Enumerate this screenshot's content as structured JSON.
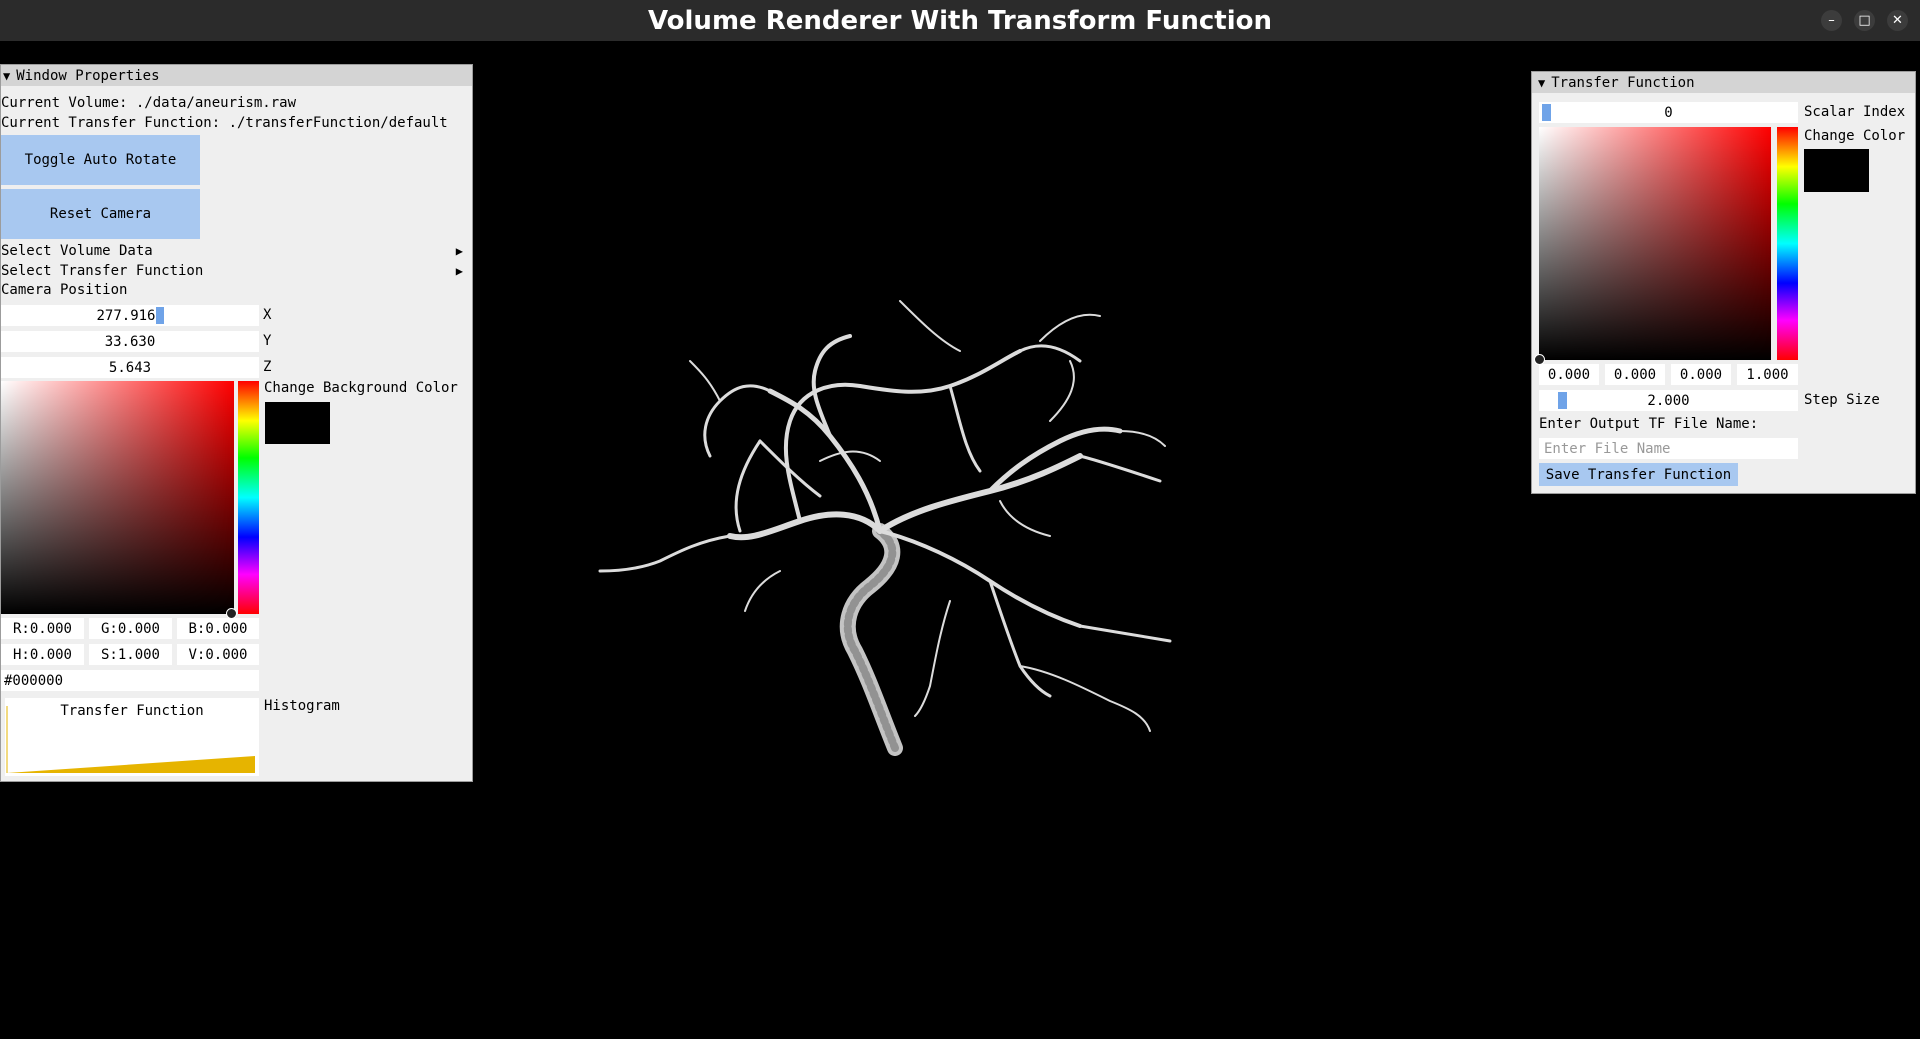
{
  "window": {
    "title": "Volume Renderer With Transform Function",
    "controls": [
      "–",
      "□",
      "✕"
    ]
  },
  "left_panel": {
    "header": "Window Properties",
    "current_volume": "Current Volume: ./data/aneurism.raw",
    "current_tf": "Current Transfer Function: ./transferFunction/default",
    "toggle_rotate": "Toggle Auto Rotate",
    "reset_camera": "Reset Camera",
    "select_volume": "Select Volume Data",
    "select_tf": "Select Transfer Function",
    "camera_position": "Camera Position",
    "cam_x": {
      "value": "277.916",
      "label": "X"
    },
    "cam_y": {
      "value": "33.630",
      "label": "Y"
    },
    "cam_z": {
      "value": "5.643",
      "label": "Z"
    },
    "bg_color_label": "Change Background Color",
    "rgb": {
      "r": "R:0.000",
      "g": "G:0.000",
      "b": "B:0.000"
    },
    "hsv": {
      "h": "H:0.000",
      "s": "S:1.000",
      "v": "V:0.000"
    },
    "hex": "#000000",
    "tf_plot_title": "Transfer Function",
    "histogram_label": "Histogram"
  },
  "right_panel": {
    "header": "Transfer Function",
    "scalar_index_value": "0",
    "scalar_index_label": "Scalar Index",
    "change_color_label": "Change Color",
    "rgba": [
      "0.000",
      "0.000",
      "0.000",
      "1.000"
    ],
    "step_size_value": "2.000",
    "step_size_label": "Step Size",
    "output_label": "Enter Output TF File Name:",
    "file_placeholder": "Enter File Name",
    "save_button": "Save Transfer Function"
  },
  "colors": {
    "accent_button": "#a8c8f0",
    "tf_fill": "#e6b400"
  }
}
